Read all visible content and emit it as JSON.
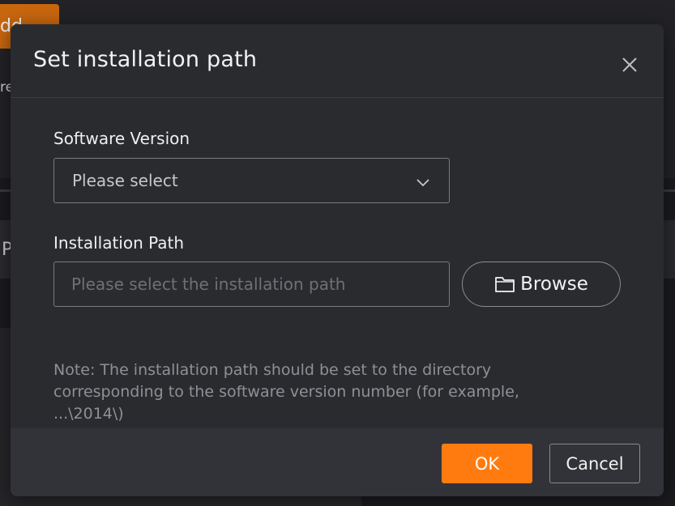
{
  "background": {
    "top_button_label": "dd",
    "side_text_1": "re",
    "side_text_2": "P"
  },
  "dialog": {
    "title": "Set installation path",
    "close_icon": "close-icon",
    "software_version": {
      "label": "Software Version",
      "placeholder": "Please select",
      "icon": "chevron-down-icon"
    },
    "installation_path": {
      "label": "Installation Path",
      "placeholder": "Please select the installation path",
      "value": ""
    },
    "browse": {
      "label": "Browse",
      "icon": "folder-icon"
    },
    "note": "Note: The installation path should be set to the directory corresponding to the software version number (for example, ...\\2014\\)",
    "ok_label": "OK",
    "cancel_label": "Cancel"
  },
  "colors": {
    "accent": "#ff7b0f",
    "dialog_bg": "#2a2b2f",
    "footer_bg": "#323338"
  }
}
